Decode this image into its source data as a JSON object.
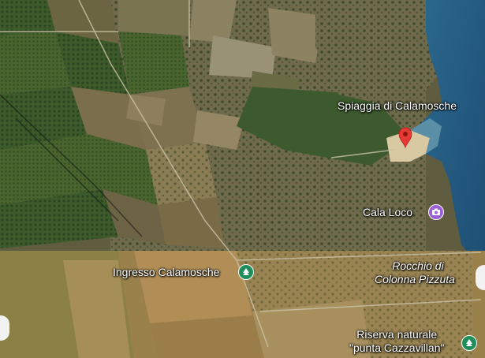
{
  "map": {
    "type": "satellite",
    "colors": {
      "sea": "#2a5f83",
      "deep_sea": "#1e4d72",
      "pin": "#e53935",
      "park_icon": "#1e8e5a",
      "camera_icon": "#9b5fd6"
    }
  },
  "places": [
    {
      "id": "spiaggia",
      "name": "Spiaggia di Calamosche",
      "icon": "location-pin-icon"
    },
    {
      "id": "cala_loco",
      "name": "Cala Loco",
      "icon": "camera-icon"
    },
    {
      "id": "ingresso",
      "name": "Ingresso Calamosche",
      "icon": "tree-icon"
    },
    {
      "id": "rocchio_1",
      "name": "Rocchio di"
    },
    {
      "id": "rocchio_2",
      "name": "Colonna Pizzuta"
    },
    {
      "id": "riserva_1",
      "name": "Riserva naturale"
    },
    {
      "id": "riserva_2",
      "name": "\"punta Cazzavillan\"",
      "icon": "tree-icon"
    }
  ]
}
